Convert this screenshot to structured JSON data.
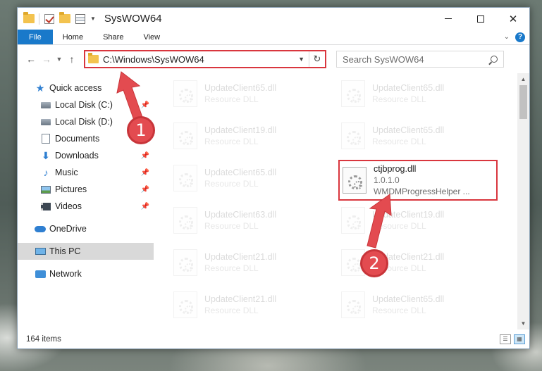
{
  "window": {
    "title": "SysWOW64"
  },
  "ribbon": {
    "tabs": [
      "File",
      "Home",
      "Share",
      "View"
    ]
  },
  "address": {
    "path": "C:\\Windows\\SysWOW64"
  },
  "search": {
    "placeholder": "Search SysWOW64"
  },
  "sidebar": {
    "quick_access": "Quick access",
    "items": [
      {
        "label": "Local Disk (C:)",
        "pinned": true
      },
      {
        "label": "Local Disk (D:)",
        "pinned": true
      },
      {
        "label": "Documents",
        "pinned": true
      },
      {
        "label": "Downloads",
        "pinned": true
      },
      {
        "label": "Music",
        "pinned": true
      },
      {
        "label": "Pictures",
        "pinned": true
      },
      {
        "label": "Videos",
        "pinned": true
      }
    ],
    "onedrive": "OneDrive",
    "this_pc": "This PC",
    "network": "Network"
  },
  "files": {
    "left": [
      {
        "name": "UpdateClient65.dll",
        "type": "Resource DLL"
      },
      {
        "name": "UpdateClient19.dll",
        "type": "Resource DLL"
      },
      {
        "name": "UpdateClient65.dll",
        "type": "Resource DLL"
      },
      {
        "name": "UpdateClient63.dll",
        "type": "Resource DLL"
      },
      {
        "name": "UpdateClient21.dll",
        "type": "Resource DLL"
      },
      {
        "name": "UpdateClient21.dll",
        "type": "Resource DLL"
      }
    ],
    "right": [
      {
        "name": "UpdateClient65.dll",
        "type": "Resource DLL"
      },
      {
        "name": "UpdateClient65.dll",
        "type": "Resource DLL"
      },
      {
        "name": "UpdateClient19.dll",
        "type": "Resource DLL"
      },
      {
        "name": "UpdateClient21.dll",
        "type": "Resource DLL"
      },
      {
        "name": "UpdateClient65.dll",
        "type": "Resource DLL"
      }
    ],
    "highlighted": {
      "name": "ctjbprog.dll",
      "version": "1.0.1.0",
      "description": "WMDMProgressHelper ..."
    }
  },
  "status": {
    "count": "164 items"
  },
  "annotations": {
    "step1": "1",
    "step2": "2",
    "accent": "#e34b50"
  }
}
